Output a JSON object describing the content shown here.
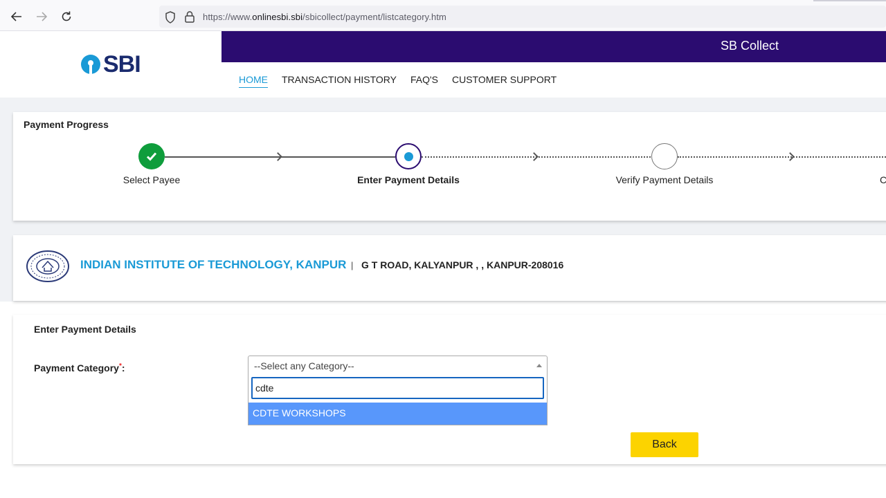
{
  "browser": {
    "url_prefix": "https://www.",
    "url_domain": "onlinesbi.sbi",
    "url_path": "/sbicollect/payment/listcategory.htm",
    "back_icon": "arrow-left-icon",
    "forward_icon": "arrow-right-icon",
    "reload_icon": "reload-icon"
  },
  "header": {
    "logo_text": "SBI",
    "product": "SB Collect",
    "menu": [
      "HOME",
      "TRANSACTION HISTORY",
      "FAQ'S",
      "CUSTOMER SUPPORT"
    ],
    "brand_color": "#2b0c70",
    "accent_color": "#1a9ad6"
  },
  "progress": {
    "title": "Payment Progress",
    "steps": [
      {
        "label": "Select Payee",
        "state": "done"
      },
      {
        "label": "Enter Payment Details",
        "state": "current"
      },
      {
        "label": "Verify Payment Details",
        "state": "pending"
      },
      {
        "label": "C",
        "state": "pending"
      }
    ]
  },
  "institute": {
    "name": "INDIAN INSTITUTE OF TECHNOLOGY, KANPUR",
    "separator": "|",
    "address": "G T ROAD, KALYANPUR , , KANPUR-208016"
  },
  "payment": {
    "title": "Enter Payment Details",
    "category_label": "Payment Category",
    "required_mark": "*",
    "label_suffix": ":",
    "selected": "--Select any Category--",
    "search_value": "cdte",
    "options": [
      "CDTE WORKSHOPS"
    ],
    "back_label": "Back"
  }
}
